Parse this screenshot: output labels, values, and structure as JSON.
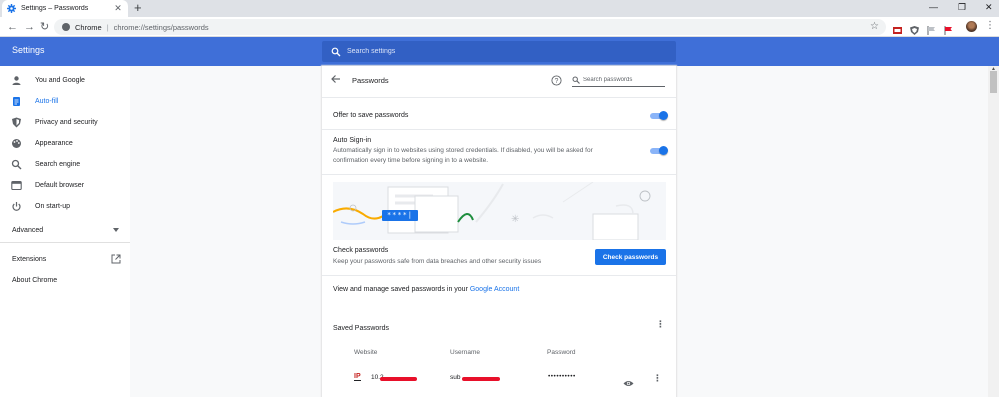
{
  "browser": {
    "tab_title": "Settings – Passwords",
    "tab_close": "✕",
    "new_tab": "+",
    "window_controls": [
      "—",
      "❐",
      "✕"
    ],
    "nav": {
      "back": "←",
      "forward": "→",
      "reload": "↻"
    },
    "omnibox": {
      "origin": "Chrome",
      "separator": "|",
      "url": "chrome://settings/passwords"
    },
    "star": "☆",
    "menu": "⋮",
    "extensions": [
      "ext-red-box-icon",
      "ext-shield-icon",
      "ext-flag-icon",
      "ext-red-flag-icon"
    ]
  },
  "header": {
    "title": "Settings",
    "search_placeholder": "Search settings"
  },
  "sidebar": {
    "items": [
      {
        "label": "You and Google",
        "icon": "person-icon"
      },
      {
        "label": "Auto-fill",
        "icon": "autofill-icon",
        "active": true
      },
      {
        "label": "Privacy and security",
        "icon": "shield-icon"
      },
      {
        "label": "Appearance",
        "icon": "palette-icon"
      },
      {
        "label": "Search engine",
        "icon": "search-icon"
      },
      {
        "label": "Default browser",
        "icon": "browser-icon"
      },
      {
        "label": "On start-up",
        "icon": "power-icon"
      }
    ],
    "advanced": "Advanced",
    "extensions": "Extensions",
    "about": "About Chrome"
  },
  "passwords": {
    "title": "Passwords",
    "search_placeholder": "Search passwords",
    "offer_to_save": {
      "label": "Offer to save passwords",
      "enabled": true
    },
    "auto_signin": {
      "label": "Auto Sign-in",
      "description_line1": "Automatically sign in to websites using stored credentials. If disabled, you will be asked for",
      "description_line2": "confirmation every time before signing in to a website.",
      "enabled": true
    },
    "illustration_mask": "****|",
    "check": {
      "title": "Check passwords",
      "description": "Keep your passwords safe from data breaches and other security issues",
      "button": "Check passwords"
    },
    "manage": {
      "text": "View and manage saved passwords in your ",
      "link": "Google Account"
    },
    "saved": {
      "title": "Saved Passwords",
      "columns": [
        "Website",
        "Username",
        "Password"
      ],
      "rows": [
        {
          "site_icon": "IP",
          "website": "10.2",
          "username": "sub",
          "password": "••••••••••"
        }
      ]
    }
  },
  "colors": {
    "accent": "#1a73e8",
    "header": "#3f6fd8",
    "redaction": "#e8102a"
  }
}
